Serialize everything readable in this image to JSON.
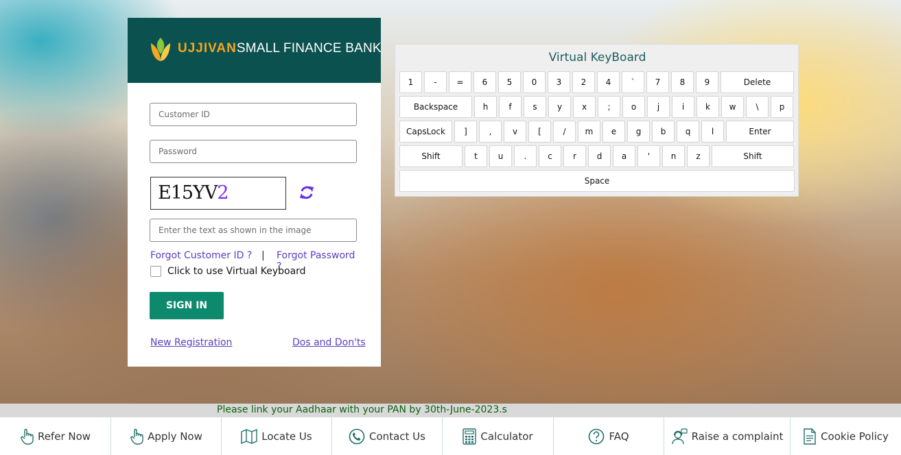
{
  "brand": {
    "name_part1": "UJJIVAN",
    "name_part2": "SMALL FINANCE BANK"
  },
  "login": {
    "customer_id_placeholder": "Customer ID",
    "password_placeholder": "Password",
    "captcha_main": "E15YV",
    "captcha_last": "2",
    "captcha_placeholder": "Enter the text as shown in the image",
    "forgot_customer_id": "Forgot Customer ID ?",
    "separator": "|",
    "forgot_password": "Forgot Password ?",
    "virtual_keyboard_label": "Click to use Virtual Keyboard",
    "signin_label": "SIGN IN",
    "new_registration": "New Registration",
    "dos_donts": "Dos and Don'ts"
  },
  "keyboard": {
    "title": "Virtual KeyBoard",
    "rows": [
      [
        "1",
        "-",
        "=",
        "6",
        "5",
        "0",
        "3",
        "2",
        "4",
        "`",
        "7",
        "8",
        "9",
        "Delete"
      ],
      [
        "Backspace",
        "h",
        "f",
        "s",
        "y",
        "x",
        ";",
        "o",
        "j",
        "i",
        "k",
        "w",
        "\\",
        "p"
      ],
      [
        "CapsLock",
        "]",
        ",",
        "v",
        "[",
        "/",
        "m",
        "e",
        "g",
        "b",
        "q",
        "l",
        "Enter"
      ],
      [
        "Shift",
        "t",
        "u",
        ".",
        "c",
        "r",
        "d",
        "a",
        "'",
        "n",
        "z",
        "Shift"
      ],
      [
        "Space"
      ]
    ]
  },
  "notice": "Please link your Aadhaar with your PAN by 30th-June-2023.s",
  "footer": [
    {
      "label": "Refer Now",
      "icon": "hand-pointer-icon"
    },
    {
      "label": "Apply Now",
      "icon": "hand-pointer-icon"
    },
    {
      "label": "Locate Us",
      "icon": "map-icon"
    },
    {
      "label": "Contact Us",
      "icon": "phone-icon"
    },
    {
      "label": "Calculator",
      "icon": "calculator-icon"
    },
    {
      "label": "FAQ",
      "icon": "question-icon"
    },
    {
      "label": "Raise a complaint",
      "icon": "support-agent-icon"
    },
    {
      "label": "Cookie Policy",
      "icon": "document-icon"
    }
  ],
  "colors": {
    "brand_green": "#0b514f",
    "button_green": "#0d8a6d",
    "link_purple": "#5a3fc0",
    "logo_orange": "#f5a623"
  }
}
